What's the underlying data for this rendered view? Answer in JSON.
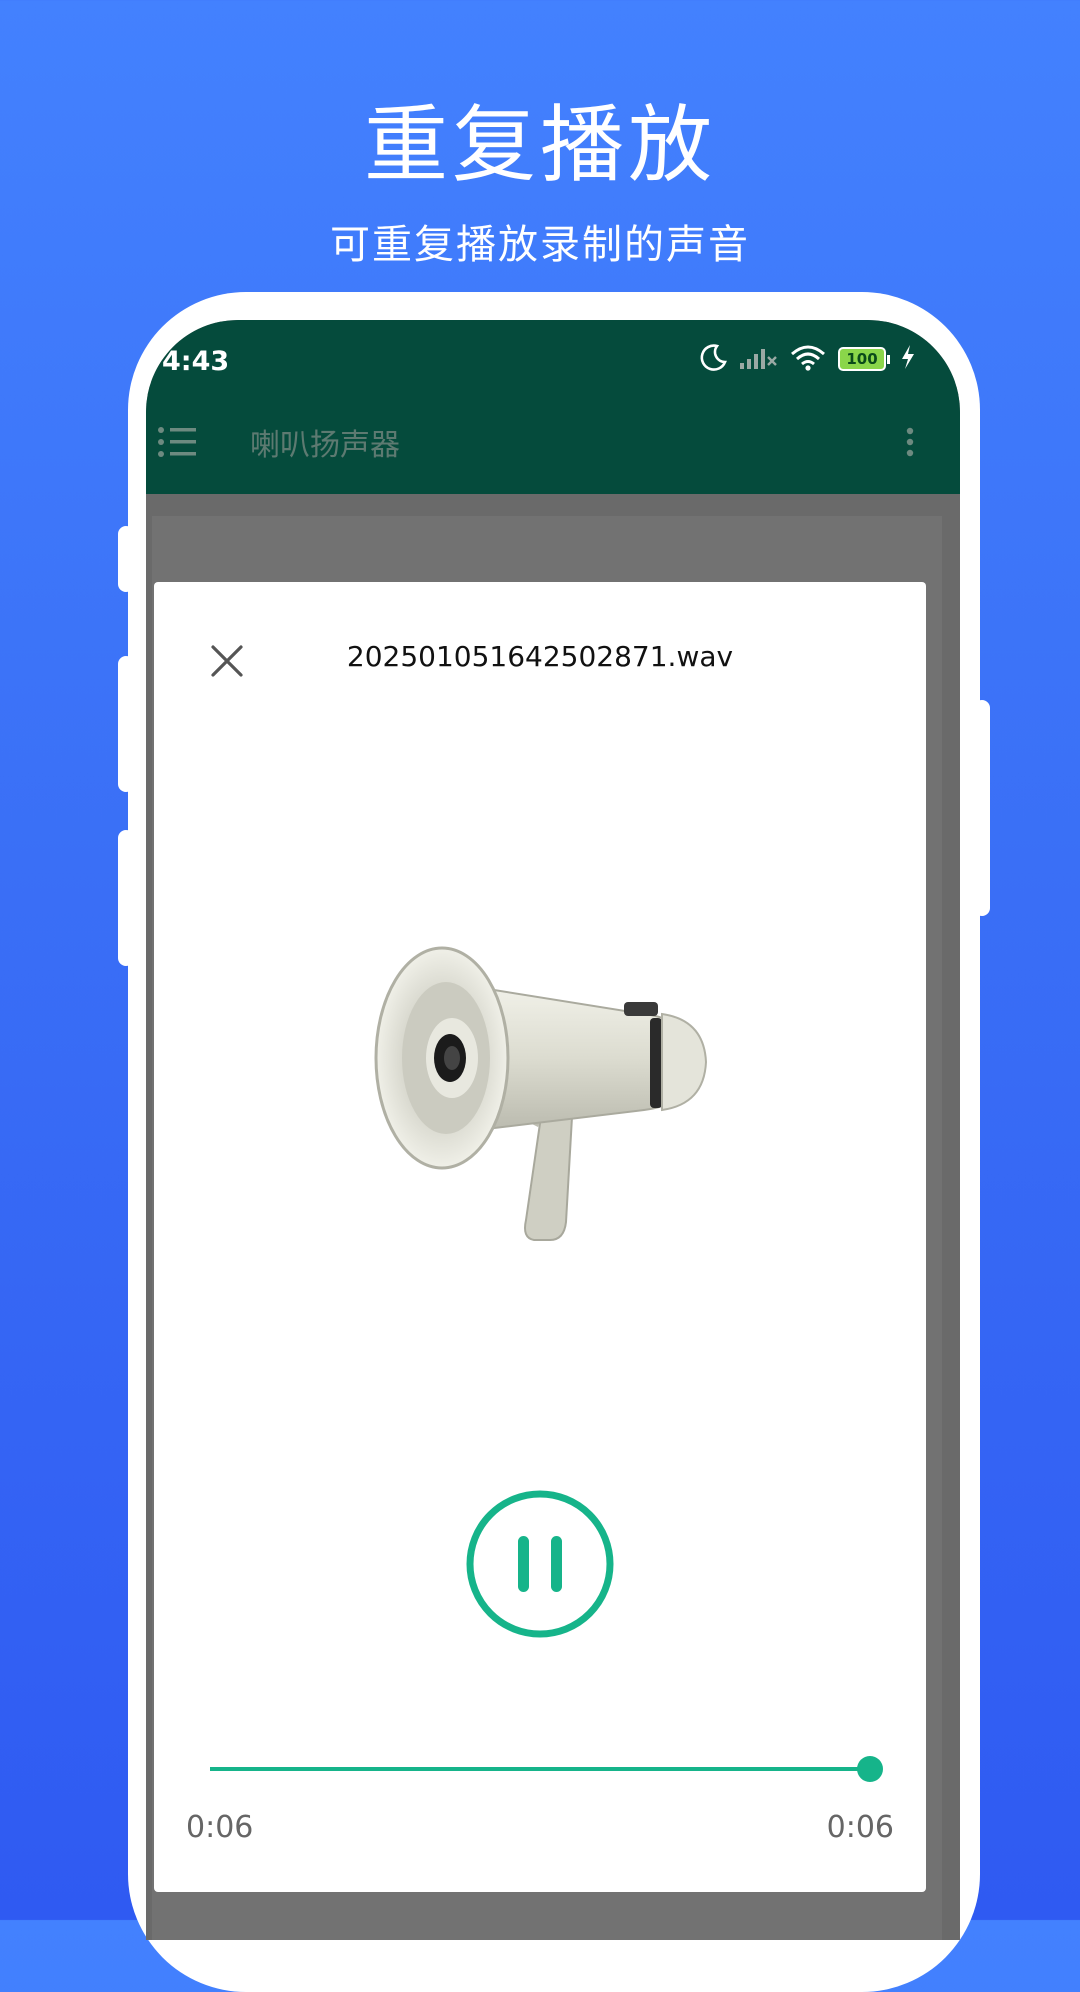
{
  "promo": {
    "title": "重复播放",
    "subtitle": "可重复播放录制的声音"
  },
  "status_bar": {
    "time": "4:43",
    "battery_level": "100"
  },
  "toolbar": {
    "title": "喇叭扬声器"
  },
  "dialog": {
    "file_name": "20250105164250287​1.wav",
    "image": "megaphone",
    "play_state": "playing"
  },
  "player": {
    "current_time": "0:06",
    "total_time": "0:06",
    "progress": 1.0
  },
  "colors": {
    "background_top": "#4381fe",
    "background_bottom": "#2f5af2",
    "appbar": "#054b3c",
    "accent": "#16b48a"
  }
}
